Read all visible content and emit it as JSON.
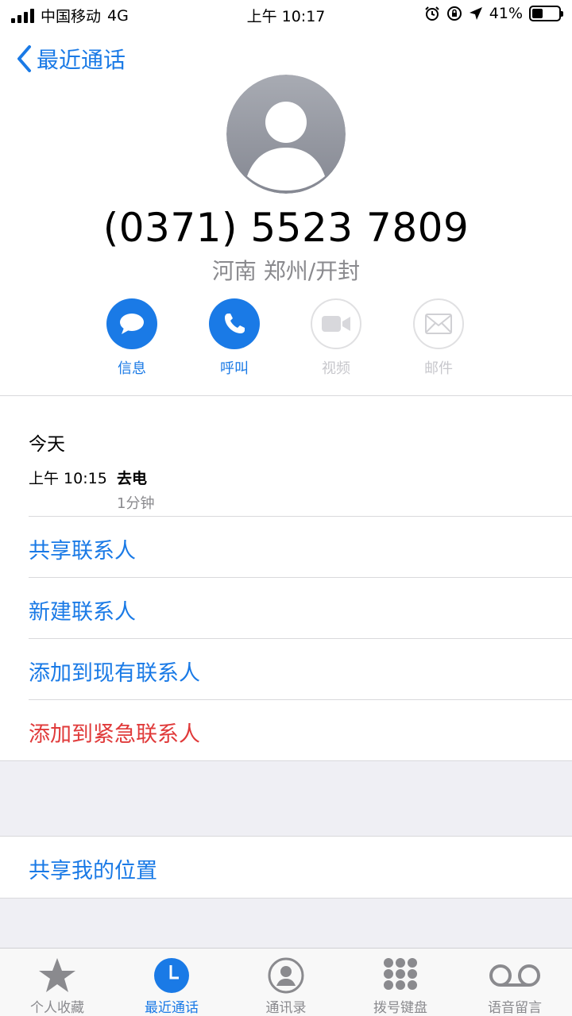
{
  "status_bar": {
    "carrier": "中国移动",
    "network": "4G",
    "time": "上午 10:17",
    "battery": "41%",
    "battery_level": 0.41
  },
  "nav": {
    "back_label": "最近通话"
  },
  "contact": {
    "phone_number": "(0371) 5523 7809",
    "location": "河南 郑州/开封"
  },
  "actions": [
    {
      "label": "信息",
      "icon": "message-icon",
      "enabled": true
    },
    {
      "label": "呼叫",
      "icon": "phone-icon",
      "enabled": true
    },
    {
      "label": "视频",
      "icon": "video-icon",
      "enabled": false
    },
    {
      "label": "邮件",
      "icon": "mail-icon",
      "enabled": false
    }
  ],
  "recent": {
    "day": "今天",
    "time": "上午 10:15",
    "type": "去电",
    "duration": "1分钟"
  },
  "menu": {
    "share_contact": "共享联系人",
    "new_contact": "新建联系人",
    "add_existing": "添加到现有联系人",
    "add_emergency": "添加到紧急联系人",
    "share_location": "共享我的位置"
  },
  "tabs": [
    {
      "label": "个人收藏",
      "icon": "star-icon",
      "active": false
    },
    {
      "label": "最近通话",
      "icon": "clock-icon",
      "active": true
    },
    {
      "label": "通讯录",
      "icon": "contacts-icon",
      "active": false
    },
    {
      "label": "拨号键盘",
      "icon": "keypad-icon",
      "active": false
    },
    {
      "label": "语音留言",
      "icon": "voicemail-icon",
      "active": false
    }
  ],
  "colors": {
    "accent": "#1a7ae6",
    "danger": "#e03a3a",
    "secondary_text": "#8a8a8e",
    "disabled": "#c7c7cc"
  }
}
